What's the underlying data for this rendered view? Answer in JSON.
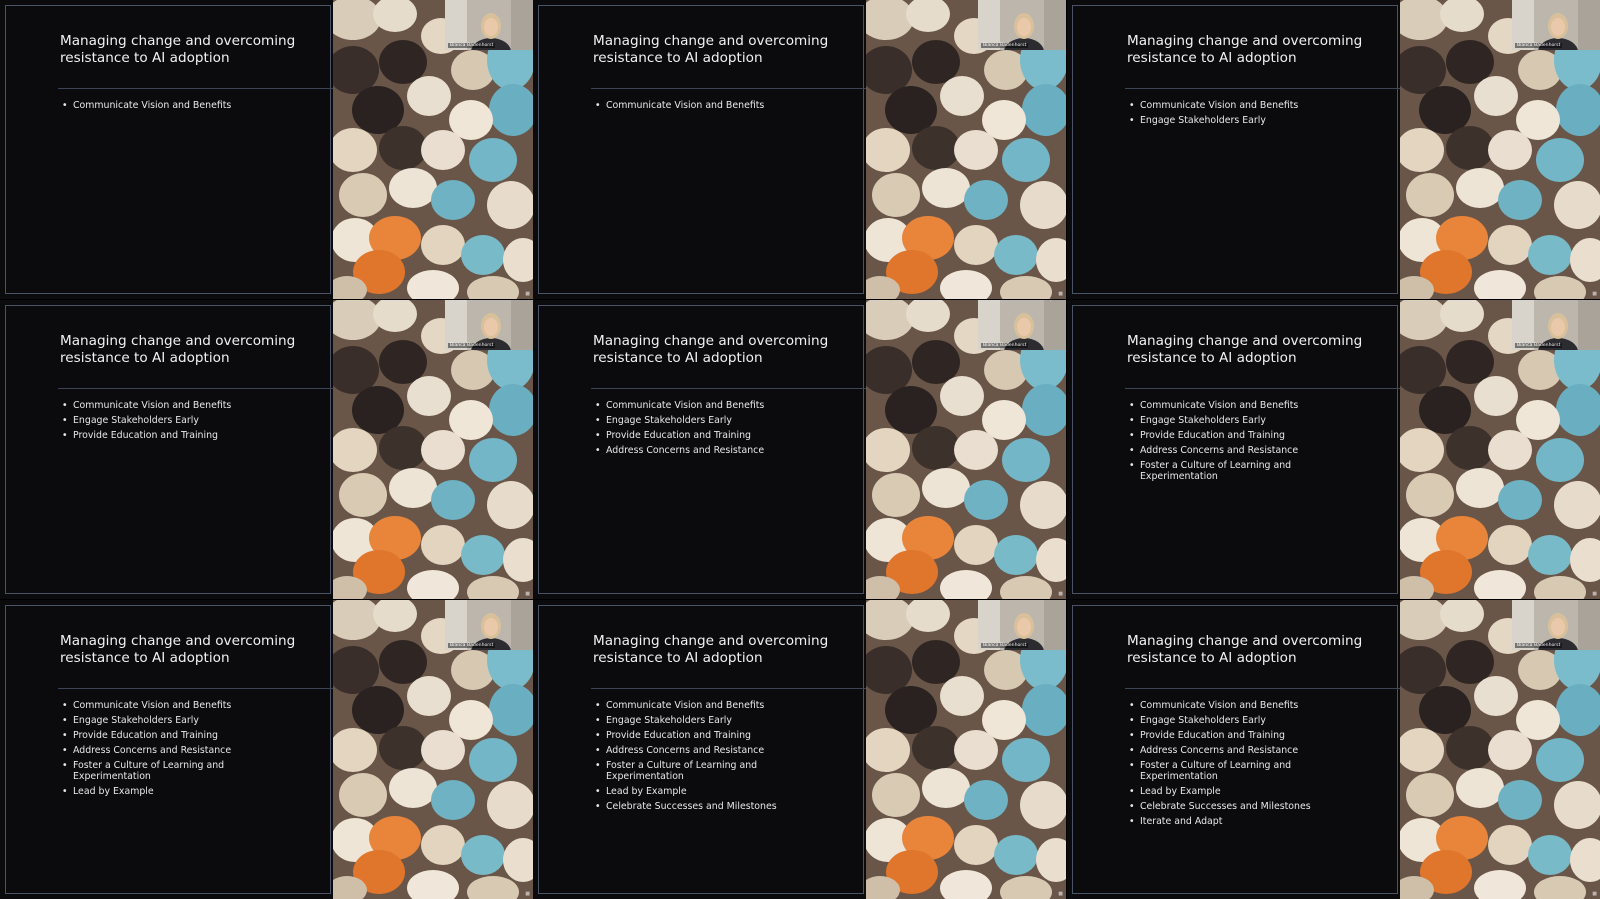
{
  "grid": {
    "slides": [
      {
        "title": "Managing change and overcoming resistance to AI adoption",
        "presenter": "Bianca Badenhorst",
        "bullets": [
          "Communicate Vision and Benefits"
        ]
      },
      {
        "title": "Managing change and overcoming resistance to AI adoption",
        "presenter": "Bianca Badenhorst",
        "bullets": [
          "Communicate Vision and Benefits"
        ]
      },
      {
        "title": "Managing change and overcoming resistance to AI adoption",
        "presenter": "Bianca Badenhorst",
        "bullets": [
          "Communicate Vision and Benefits",
          "Engage Stakeholders Early"
        ]
      },
      {
        "title": "Managing change and overcoming resistance to AI adoption",
        "presenter": "Bianca Badenhorst",
        "bullets": [
          "Communicate Vision and Benefits",
          "Engage Stakeholders Early",
          "Provide Education and Training"
        ]
      },
      {
        "title": "Managing change and overcoming resistance to AI adoption",
        "presenter": "Bianca Badenhorst",
        "bullets": [
          "Communicate Vision and Benefits",
          "Engage Stakeholders Early",
          "Provide Education and Training",
          "Address Concerns and Resistance"
        ]
      },
      {
        "title": "Managing change and overcoming resistance to AI adoption",
        "presenter": "Bianca Badenhorst",
        "bullets": [
          "Communicate Vision and Benefits",
          "Engage Stakeholders Early",
          "Provide Education and Training",
          "Address Concerns and Resistance",
          "Foster a Culture of Learning and Experimentation"
        ]
      },
      {
        "title": "Managing change and overcoming resistance to AI adoption",
        "presenter": "Bianca Badenhorst",
        "bullets": [
          "Communicate Vision and Benefits",
          "Engage Stakeholders Early",
          "Provide Education and Training",
          "Address Concerns and Resistance",
          "Foster a Culture of Learning and Experimentation",
          "Lead by Example"
        ]
      },
      {
        "title": "Managing change and overcoming resistance to AI adoption",
        "presenter": "Bianca Badenhorst",
        "bullets": [
          "Communicate Vision and Benefits",
          "Engage Stakeholders Early",
          "Provide Education and Training",
          "Address Concerns and Resistance",
          "Foster a Culture of Learning and Experimentation",
          "Lead by Example",
          "Celebrate Successes and Milestones"
        ]
      },
      {
        "title": "Managing change and overcoming resistance to AI adoption",
        "presenter": "Bianca Badenhorst",
        "bullets": [
          "Communicate Vision and Benefits",
          "Engage Stakeholders Early",
          "Provide Education and Training",
          "Address Concerns and Resistance",
          "Foster a Culture of Learning and Experimentation",
          "Lead by Example",
          "Celebrate Successes and Milestones",
          "Iterate and Adapt"
        ]
      }
    ]
  },
  "colors": {
    "slide_background": "#0b0b0d",
    "frame_border": "#4a5466",
    "text": "#f2f2f2",
    "figure_orange": "#e8853a",
    "figure_blue": "#6fb3c4",
    "figure_cream": "#e6d9c4",
    "figure_dark": "#3b2f2c"
  },
  "icons": {
    "bullet": "bullet-dot-icon"
  }
}
